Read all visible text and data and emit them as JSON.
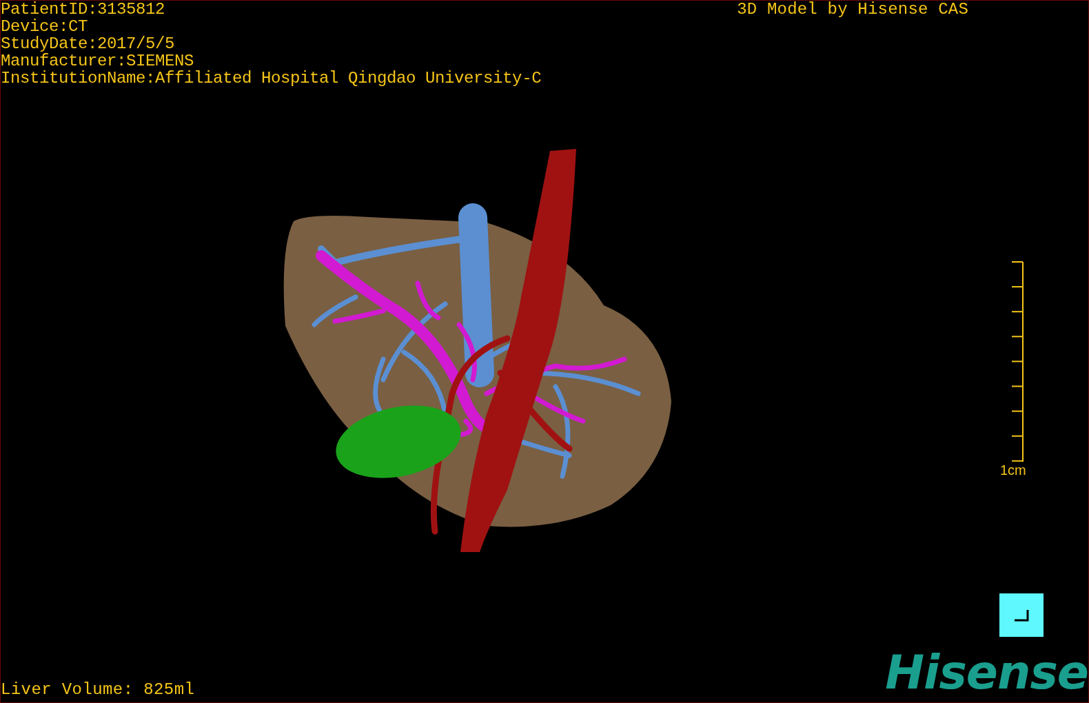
{
  "info_lines": [
    "PatientID:3135812",
    "Device:CT",
    "StudyDate:2017/5/5",
    "Manufacturer:SIEMENS",
    "InstitutionName:Affiliated Hospital Qingdao University-C"
  ],
  "title": "3D Model by Hisense CAS",
  "scale": {
    "label": "1cm"
  },
  "liver_volume": "Liver Volume: 825ml",
  "logo": "Hisense"
}
